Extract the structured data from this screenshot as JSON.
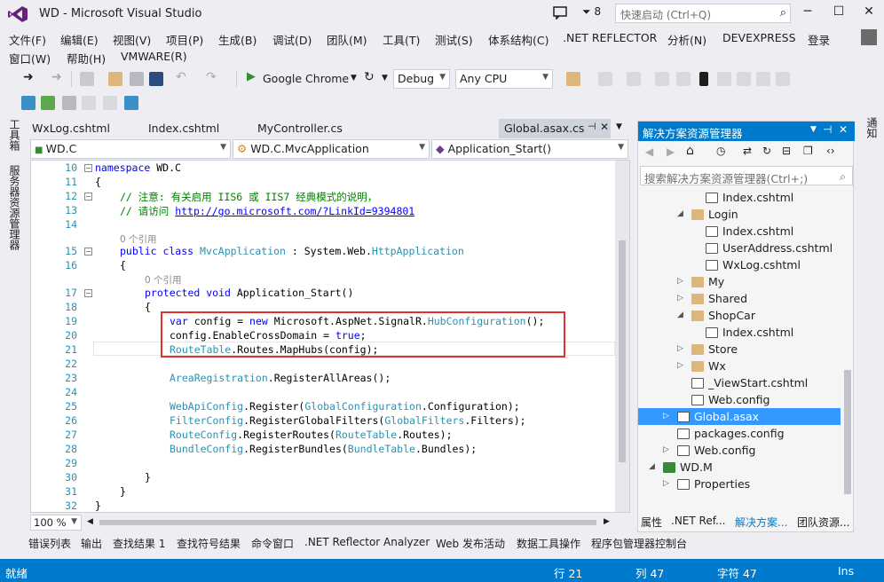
{
  "window": {
    "title": "WD - Microsoft Visual Studio",
    "notification_count": "8",
    "quick_launch_placeholder": "快速启动 (Ctrl+Q)"
  },
  "menu": {
    "row1": [
      "文件(F)",
      "编辑(E)",
      "视图(V)",
      "项目(P)",
      "生成(B)",
      "调试(D)",
      "团队(M)",
      "工具(T)",
      "测试(S)",
      "体系结构(C)",
      ".NET REFLECTOR",
      "分析(N)",
      "DEVEXPRESS"
    ],
    "row2": [
      "窗口(W)",
      "帮助(H)",
      "VMWARE(R)"
    ],
    "login": "登录"
  },
  "toolbar": {
    "browser": "Google Chrome",
    "config": "Debug",
    "platform": "Any CPU"
  },
  "left_tabs": [
    "工具箱",
    "服务器资源管理器"
  ],
  "right_tab": "通知",
  "doc_tabs": [
    "WxLog.cshtml",
    "Index.cshtml",
    "MyController.cs",
    "Global.asax.cs"
  ],
  "navbar": {
    "project": "WD.C",
    "class": "WD.C.MvcApplication",
    "member": "Application_Start()"
  },
  "editor": {
    "line_numbers": [
      "10",
      "11",
      "12",
      "13",
      "14",
      "",
      "15",
      "16",
      "",
      "17",
      "18",
      "19",
      "20",
      "21",
      "22",
      "23",
      "24",
      "25",
      "26",
      "27",
      "28",
      "29",
      "30",
      "31",
      "32"
    ],
    "comment1": "// 注意: 有关启用 IIS6 或 IIS7 经典模式的说明，",
    "comment2_prefix": "// 请访问 ",
    "comment2_link": "http://go.microsoft.com/?LinkId=9394801",
    "ref_count_1": "0 个引用",
    "ref_count_2": "0 个引用",
    "zoom": "100 %"
  },
  "solution_explorer": {
    "title": "解决方案资源管理器",
    "search_placeholder": "搜索解决方案资源管理器(Ctrl+;)",
    "items": [
      {
        "label": "Index.cshtml",
        "indent": 4,
        "type": "file",
        "expander": ""
      },
      {
        "label": "Login",
        "indent": 3,
        "type": "folder",
        "expander": "open"
      },
      {
        "label": "Index.cshtml",
        "indent": 4,
        "type": "file",
        "expander": ""
      },
      {
        "label": "UserAddress.cshtml",
        "indent": 4,
        "type": "file",
        "expander": ""
      },
      {
        "label": "WxLog.cshtml",
        "indent": 4,
        "type": "file",
        "expander": ""
      },
      {
        "label": "My",
        "indent": 3,
        "type": "folder",
        "expander": "closed"
      },
      {
        "label": "Shared",
        "indent": 3,
        "type": "folder",
        "expander": "closed"
      },
      {
        "label": "ShopCar",
        "indent": 3,
        "type": "folder",
        "expander": "open"
      },
      {
        "label": "Index.cshtml",
        "indent": 4,
        "type": "file",
        "expander": ""
      },
      {
        "label": "Store",
        "indent": 3,
        "type": "folder",
        "expander": "closed"
      },
      {
        "label": "Wx",
        "indent": 3,
        "type": "folder",
        "expander": "closed"
      },
      {
        "label": "_ViewStart.cshtml",
        "indent": 3,
        "type": "file",
        "expander": ""
      },
      {
        "label": "Web.config",
        "indent": 3,
        "type": "file",
        "expander": ""
      },
      {
        "label": "Global.asax",
        "indent": 2,
        "type": "file",
        "expander": "closed",
        "selected": true
      },
      {
        "label": "packages.config",
        "indent": 2,
        "type": "file",
        "expander": ""
      },
      {
        "label": "Web.config",
        "indent": 2,
        "type": "file",
        "expander": "closed"
      },
      {
        "label": "WD.M",
        "indent": 1,
        "type": "project",
        "expander": "open"
      },
      {
        "label": "Properties",
        "indent": 2,
        "type": "file",
        "expander": "closed"
      }
    ],
    "tabs": [
      "属性",
      ".NET Ref...",
      "解决方案...",
      "团队资源..."
    ]
  },
  "bottom_tabs": [
    "错误列表",
    "输出",
    "查找结果 1",
    "查找符号结果",
    "命令窗口",
    ".NET Reflector Analyzer",
    "Web 发布活动",
    "数据工具操作",
    "程序包管理器控制台"
  ],
  "status": {
    "state": "就绪",
    "line": "行 21",
    "col": "列 47",
    "char": "字符 47",
    "mode": "Ins"
  },
  "colors": {
    "accent": "#007acc",
    "highlight_box": "#e03030",
    "selected_item": "#3399ff"
  }
}
